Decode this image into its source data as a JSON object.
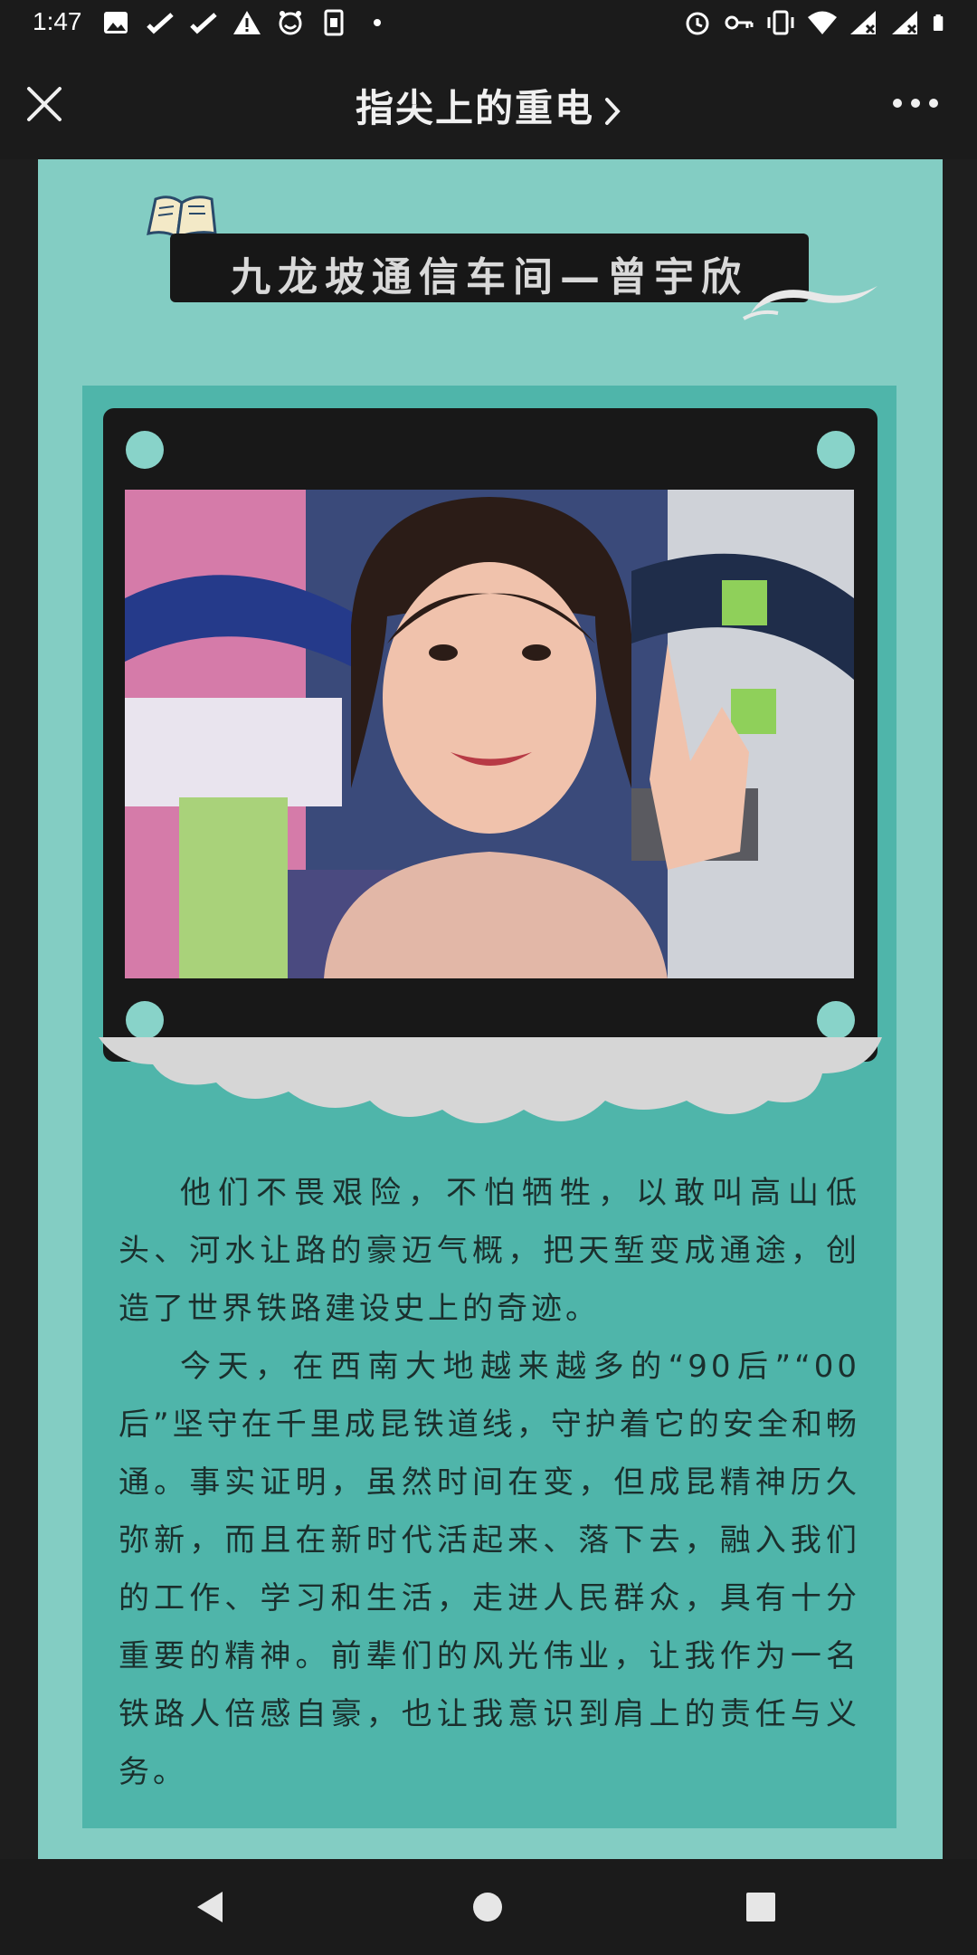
{
  "status_bar": {
    "time": "1:47",
    "left_icons": [
      "image-icon",
      "check-icon",
      "check-icon",
      "warning-icon",
      "face-icon",
      "sim-icon",
      "dot-icon"
    ],
    "right_icons": [
      "alarm-icon",
      "key-icon",
      "vibrate-icon",
      "wifi-icon",
      "signal-icon",
      "signal-icon",
      "battery-icon"
    ]
  },
  "titlebar": {
    "title": "指尖上的重电",
    "close_icon": "close-icon",
    "more_icon": "more-icon"
  },
  "article": {
    "banner_title": "九龙坡通信车间—曾宇欣",
    "photo_icon": "portrait-photo",
    "paragraphs": [
      "他们不畏艰险，不怕牺牲，以敢叫高山低头、河水让路的豪迈气概，把天堑变成通途，创造了世界铁路建设史上的奇迹。",
      "今天，在西南大地越来越多的“90后”“00后”坚守在千里成昆铁道线，守护着它的安全和畅通。事实证明，虽然时间在变，但成昆精神历久弥新，而且在新时代活起来、落下去，融入我们的工作、学习和生活，走进人民群众，具有十分重要的精神。前辈们的风光伟业，让我作为一名铁路人倍感自豪，也让我意识到肩上的责任与义务。"
    ]
  },
  "colors": {
    "panel": "#83cdc3",
    "inner": "#4fb5aa",
    "frame": "#181818",
    "banner_text": "#d9d9d9"
  },
  "navbar": {
    "back_icon": "back-icon",
    "home_icon": "home-icon",
    "recents_icon": "recents-icon"
  }
}
